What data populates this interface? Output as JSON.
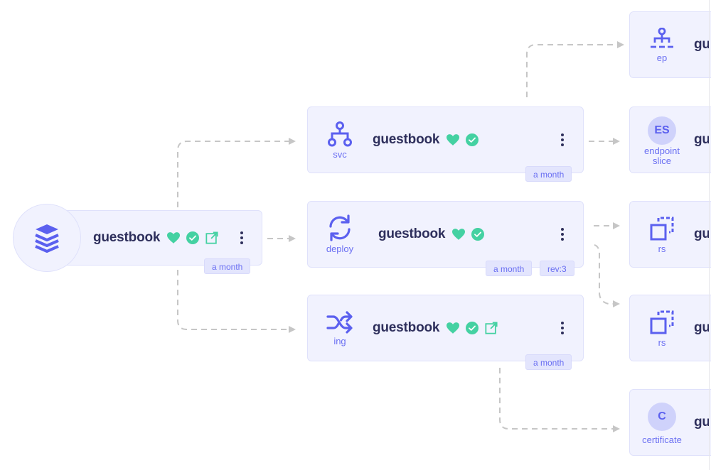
{
  "colors": {
    "accent": "#6a6ff2",
    "node_bg": "#f1f2fe",
    "node_border": "#dfe1fb",
    "health": "#44d1a2",
    "text": "#2e2f5c",
    "edge": "#c6c6c6"
  },
  "nodes": {
    "root": {
      "kind": "application",
      "kind_icon": "layers-icon",
      "name": "guestbook",
      "health": "healthy",
      "sync": "synced",
      "has_link": true,
      "age": "a month"
    },
    "svc": {
      "kind": "svc",
      "kind_icon": "network-tree-icon",
      "name": "guestbook",
      "health": "healthy",
      "sync": "synced",
      "age": "a month"
    },
    "deploy": {
      "kind": "deploy",
      "kind_icon": "sync-arrows-icon",
      "name": "guestbook",
      "health": "healthy",
      "sync": "synced",
      "age": "a month",
      "revision": "rev:3"
    },
    "ing": {
      "kind": "ing",
      "kind_icon": "shuffle-icon",
      "name": "guestbook",
      "health": "healthy",
      "sync": "synced",
      "has_link": true,
      "age": "a month"
    },
    "ep": {
      "kind": "ep",
      "kind_icon": "endpoint-hub-icon",
      "name_visible": "gu"
    },
    "endpointslice": {
      "kind": "endpoint slice",
      "kind_line1": "endpoint",
      "kind_line2": "slice",
      "badge": "ES",
      "name_visible": "gu"
    },
    "rs1": {
      "kind": "rs",
      "kind_icon": "replicaset-icon",
      "name_visible": "gu"
    },
    "rs2": {
      "kind": "rs",
      "kind_icon": "replicaset-icon",
      "name_visible": "gu"
    },
    "certificate": {
      "kind": "certificate",
      "badge": "C",
      "name_visible": "gu"
    }
  },
  "edges": [
    {
      "from": "root",
      "to": "svc"
    },
    {
      "from": "root",
      "to": "deploy"
    },
    {
      "from": "root",
      "to": "ing"
    },
    {
      "from": "svc",
      "to": "ep"
    },
    {
      "from": "svc",
      "to": "endpointslice"
    },
    {
      "from": "deploy",
      "to": "rs1"
    },
    {
      "from": "deploy",
      "to": "rs2"
    },
    {
      "from": "ing",
      "to": "certificate"
    }
  ]
}
